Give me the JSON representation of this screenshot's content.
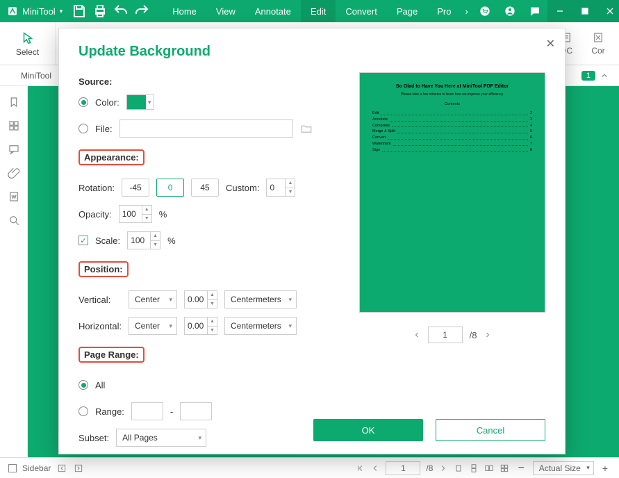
{
  "menubar": {
    "brand": "MiniTool",
    "tabs": [
      "Home",
      "View",
      "Annotate",
      "Edit",
      "Convert",
      "Page",
      "Pro"
    ],
    "active_tab_index": 3
  },
  "ribbon": {
    "select_label": "Select",
    "right_items": [
      "OC",
      "Cor"
    ]
  },
  "doctabs": {
    "tab_label": "MiniTool",
    "badge": "1"
  },
  "dialog": {
    "title": "Update Background",
    "sections": {
      "source": "Source:",
      "appearance": "Appearance:",
      "position": "Position:",
      "page_range": "Page Range:"
    },
    "source": {
      "color_label": "Color:",
      "file_label": "File:"
    },
    "appearance": {
      "rotation_label": "Rotation:",
      "rot_neg45": "-45",
      "rot_0": "0",
      "rot_45": "45",
      "custom_label": "Custom:",
      "custom_value": "0",
      "opacity_label": "Opacity:",
      "opacity_value": "100",
      "opacity_unit": "%",
      "scale_label": "Scale:",
      "scale_value": "100",
      "scale_unit": "%"
    },
    "position": {
      "vertical_label": "Vertical:",
      "horizontal_label": "Horizontal:",
      "align_value": "Center",
      "offset_value": "0.00",
      "unit_value": "Centermeters"
    },
    "page_range": {
      "all_label": "All",
      "range_label": "Range:",
      "range_sep": "-",
      "subset_label": "Subset:",
      "subset_value": "All Pages"
    },
    "pager": {
      "current": "1",
      "total": "/8"
    },
    "footer": {
      "ok": "OK",
      "cancel": "Cancel"
    },
    "preview": {
      "title": "So Glad to Have You Here at MiniTool PDF Editor",
      "subtitle": "Please take a few minutes to learn how we improve your efficiency.",
      "contents_heading": "Contents",
      "toc": [
        {
          "label": "Edit",
          "page": "2"
        },
        {
          "label": "Annotate",
          "page": "3"
        },
        {
          "label": "Compress",
          "page": "4"
        },
        {
          "label": "Merge & Split",
          "page": "5"
        },
        {
          "label": "Convert",
          "page": "6"
        },
        {
          "label": "Watermark",
          "page": "7"
        },
        {
          "label": "Sign",
          "page": "8"
        }
      ]
    }
  },
  "statusbar": {
    "sidebar_label": "Sidebar",
    "page_current": "1",
    "page_total": "/8",
    "zoom_label": "Actual Size",
    "minus": "−",
    "plus": "+"
  }
}
